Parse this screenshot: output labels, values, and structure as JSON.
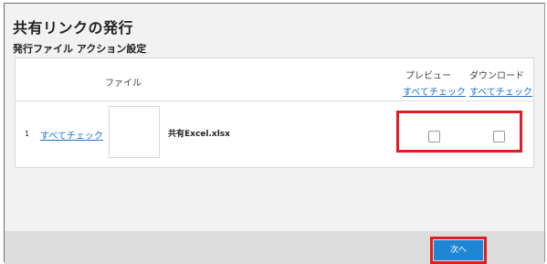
{
  "dialog": {
    "title": "共有リンクの発行",
    "subtitle": "発行ファイル アクション設定"
  },
  "table": {
    "header_file": "ファイル",
    "header_preview": "プレビュー",
    "header_download": "ダウンロード",
    "check_all_preview": "すべてチェック",
    "check_all_download": "すべてチェック",
    "rows": [
      {
        "index": "1",
        "check_all": "すべてチェック",
        "file_name": "共有Excel.xlsx",
        "preview_checked": false,
        "download_checked": false
      }
    ]
  },
  "footer": {
    "next_label": "次へ"
  },
  "colors": {
    "link": "#1a73c9",
    "highlight": "#e31b23",
    "primary_button": "#1f86d6"
  }
}
